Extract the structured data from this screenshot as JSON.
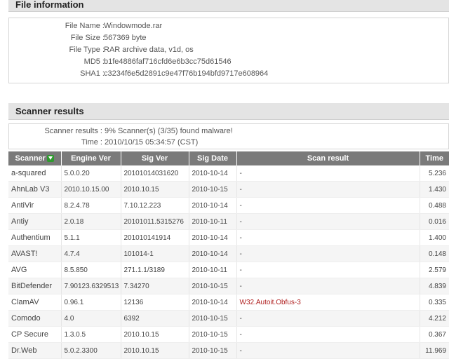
{
  "file_info": {
    "header": "File information",
    "rows": [
      {
        "label": "File Name :",
        "value": "Windowmode.rar"
      },
      {
        "label": "File Size :",
        "value": "567369 byte"
      },
      {
        "label": "File Type :",
        "value": "RAR archive data, v1d, os"
      },
      {
        "label": "MD5 :",
        "value": "b1fe4886faf716cfd6e6b3cc75d61546"
      },
      {
        "label": "SHA1 :",
        "value": "c3234f6e5d2891c9e47f76b194bfd9717e608964"
      }
    ]
  },
  "scanner_info": {
    "header": "Scanner results",
    "rows": [
      {
        "label": "Scanner results :",
        "value": "9% Scanner(s) (3/35) found malware!"
      },
      {
        "label": "Time :",
        "value": "2010/10/15 05:34:57 (CST)"
      }
    ]
  },
  "results_table": {
    "columns": [
      "Scanner",
      "Engine Ver",
      "Sig Ver",
      "Sig Date",
      "Scan result",
      "Time"
    ],
    "sort_icon": "sort-down-arrow-icon",
    "rows": [
      {
        "scanner": "a-squared",
        "engine": "5.0.0.20",
        "sig": "20101014031620",
        "date": "2010-10-14",
        "result": "-",
        "time": "5.236",
        "malware": false
      },
      {
        "scanner": "AhnLab V3",
        "engine": "2010.10.15.00",
        "sig": "2010.10.15",
        "date": "2010-10-15",
        "result": "-",
        "time": "1.430",
        "malware": false
      },
      {
        "scanner": "AntiVir",
        "engine": "8.2.4.78",
        "sig": "7.10.12.223",
        "date": "2010-10-14",
        "result": "-",
        "time": "0.488",
        "malware": false
      },
      {
        "scanner": "Antiy",
        "engine": "2.0.18",
        "sig": "20101011.5315276",
        "date": "2010-10-11",
        "result": "-",
        "time": "0.016",
        "malware": false
      },
      {
        "scanner": "Authentium",
        "engine": "5.1.1",
        "sig": "201010141914",
        "date": "2010-10-14",
        "result": "-",
        "time": "1.400",
        "malware": false
      },
      {
        "scanner": "AVAST!",
        "engine": "4.7.4",
        "sig": "101014-1",
        "date": "2010-10-14",
        "result": "-",
        "time": "0.148",
        "malware": false
      },
      {
        "scanner": "AVG",
        "engine": "8.5.850",
        "sig": "271.1.1/3189",
        "date": "2010-10-11",
        "result": "-",
        "time": "2.579",
        "malware": false
      },
      {
        "scanner": "BitDefender",
        "engine": "7.90123.6329513",
        "sig": "7.34270",
        "date": "2010-10-15",
        "result": "-",
        "time": "4.839",
        "malware": false
      },
      {
        "scanner": "ClamAV",
        "engine": "0.96.1",
        "sig": "12136",
        "date": "2010-10-14",
        "result": "W32.Autoit.Obfus-3",
        "time": "0.335",
        "malware": true
      },
      {
        "scanner": "Comodo",
        "engine": "4.0",
        "sig": "6392",
        "date": "2010-10-15",
        "result": "-",
        "time": "4.212",
        "malware": false
      },
      {
        "scanner": "CP Secure",
        "engine": "1.3.0.5",
        "sig": "2010.10.15",
        "date": "2010-10-15",
        "result": "-",
        "time": "0.367",
        "malware": false
      },
      {
        "scanner": "Dr.Web",
        "engine": "5.0.2.3300",
        "sig": "2010.10.15",
        "date": "2010-10-15",
        "result": "-",
        "time": "11.969",
        "malware": false
      }
    ]
  }
}
